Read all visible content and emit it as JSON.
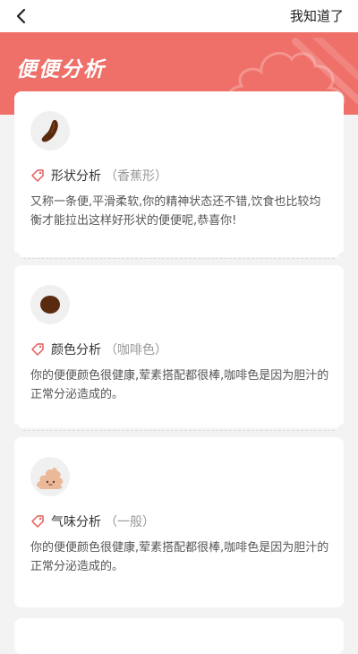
{
  "header": {
    "back_label": "",
    "confirm_label": "我知道了"
  },
  "hero": {
    "title": "便便分析",
    "background_color": "#ef7069"
  },
  "sections": [
    {
      "icon": "banana-shaped-stool-icon",
      "title": "形状分析",
      "subtitle": "（香蕉形）",
      "description": "又称一条便,平滑柔软,你的精神状态还不错,饮食也比较均衡才能拉出这样好形状的便便呢,恭喜你!"
    },
    {
      "icon": "brown-dot-icon",
      "title": "颜色分析",
      "subtitle": "（咖啡色）",
      "description": "你的便便颜色很健康,荤素搭配都很棒,咖啡色是因为胆汁的正常分泌造成的。"
    },
    {
      "icon": "poop-face-icon",
      "title": "气味分析",
      "subtitle": "（一般）",
      "description": "你的便便颜色很健康,荤素搭配都很棒,咖啡色是因为胆汁的正常分泌造成的。"
    }
  ],
  "colors": {
    "accent": "#ef7069",
    "tag_icon": "#e45c5c",
    "stool_brown": "#5a2a0f"
  }
}
